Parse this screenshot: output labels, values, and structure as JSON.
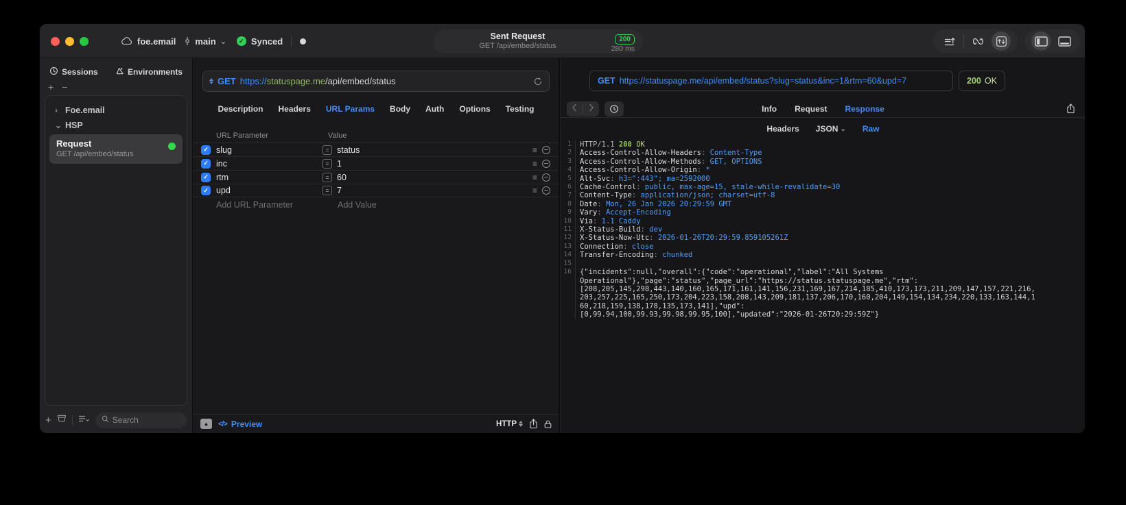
{
  "colors": {
    "accent_blue": "#3f8cfc",
    "success_green": "#2fd158",
    "host_green": "#8fb764",
    "code_value_blue": "#4f9ef8",
    "status_green": "#9fcd70"
  },
  "icons": [
    "cloud-icon",
    "branch-icon",
    "chevron-down-icon",
    "check-circle-icon",
    "clock-icon",
    "environments-icon",
    "plus-icon",
    "minus-icon",
    "folder-icon",
    "list-icon",
    "search-icon",
    "reload-icon",
    "method-updown-icon",
    "drag-handle-icon",
    "remove-row-icon",
    "panel-toggle-icon",
    "code-preview-icon",
    "share-icon",
    "lock-icon",
    "back-icon",
    "forward-icon",
    "history-icon",
    "import-lines-icon",
    "flow-loop-icon",
    "transfer-box-icon",
    "layout-sidebar-icon",
    "layout-bottom-icon"
  ],
  "titlebar": {
    "project": "foe.email",
    "branch": "main",
    "sync_status": "Synced",
    "request_title": "Sent Request",
    "request_subtitle": "GET /api/embed/status",
    "status_badge": "200",
    "duration": "280 ms"
  },
  "sidebar": {
    "tabs": [
      {
        "label": "Sessions"
      },
      {
        "label": "Environments"
      }
    ],
    "tree": [
      {
        "label": "Foe.email",
        "state": "collapsed"
      },
      {
        "label": "HSP",
        "state": "expanded"
      }
    ],
    "selected_request": {
      "title": "Request",
      "subtitle": "GET /api/embed/status"
    },
    "search_placeholder": "Search"
  },
  "request_panel": {
    "method": "GET",
    "url_scheme": "https://",
    "url_host": "statuspage.me",
    "url_path": "/api/embed/status",
    "tabs": [
      "Description",
      "Headers",
      "URL Params",
      "Body",
      "Auth",
      "Options",
      "Testing"
    ],
    "active_tab": "URL Params",
    "params_table": {
      "columns": [
        "URL Parameter",
        "Value"
      ],
      "rows": [
        {
          "name": "slug",
          "value": "status",
          "enabled": true
        },
        {
          "name": "inc",
          "value": "1",
          "enabled": true
        },
        {
          "name": "rtm",
          "value": "60",
          "enabled": true
        },
        {
          "name": "upd",
          "value": "7",
          "enabled": true
        }
      ],
      "add_name_placeholder": "Add URL Parameter",
      "add_value_placeholder": "Add Value"
    },
    "footer": {
      "preview_label": "Preview",
      "http_label": "HTTP"
    }
  },
  "response_panel": {
    "request_line": {
      "method": "GET",
      "url": "https://statuspage.me/api/embed/status?slug=status&inc=1&rtm=60&upd=7"
    },
    "status": {
      "code": "200",
      "text": "OK"
    },
    "tabs": [
      "Info",
      "Request",
      "Response"
    ],
    "active_tab": "Response",
    "subtabs": [
      "Headers",
      "JSON",
      "Raw"
    ],
    "active_subtab": "Raw",
    "status_line": {
      "protocol": "HTTP/1.1",
      "code": "200",
      "text": "OK"
    },
    "headers": [
      {
        "name": "Access-Control-Allow-Headers",
        "value": "Content-Type"
      },
      {
        "name": "Access-Control-Allow-Methods",
        "value": "GET, OPTIONS"
      },
      {
        "name": "Access-Control-Allow-Origin",
        "value": "*"
      },
      {
        "name": "Alt-Svc",
        "value": "h3=\":443\"; ma=2592000"
      },
      {
        "name": "Cache-Control",
        "value": "public, max-age=15, stale-while-revalidate=30"
      },
      {
        "name": "Content-Type",
        "value": "application/json; charset=utf-8"
      },
      {
        "name": "Date",
        "value": "Mon, 26 Jan 2026 20:29:59 GMT"
      },
      {
        "name": "Vary",
        "value": "Accept-Encoding"
      },
      {
        "name": "Via",
        "value": "1.1 Caddy"
      },
      {
        "name": "X-Status-Build",
        "value": "dev"
      },
      {
        "name": "X-Status-Now-Utc",
        "value": "2026-01-26T20:29:59.859105261Z"
      },
      {
        "name": "Connection",
        "value": "close"
      },
      {
        "name": "Transfer-Encoding",
        "value": "chunked"
      }
    ],
    "body_lines": [
      "{\"incidents\":null,\"overall\":{\"code\":\"operational\",\"label\":\"All Systems",
      "Operational\"},\"page\":\"status\",\"page_url\":\"https://status.statuspage.me\",\"rtm\":",
      "[208,205,145,298,443,140,160,165,171,161,141,156,231,169,167,214,185,410,173,173,211,209,147,157,221,216,",
      "203,257,225,165,250,173,204,223,158,208,143,209,181,137,206,170,160,204,149,154,134,234,220,133,163,144,1",
      "60,218,159,138,178,135,173,141],\"upd\":",
      "[0,99.94,100,99.93,99.98,99.95,100],\"updated\":\"2026-01-26T20:29:59Z\"}"
    ]
  }
}
